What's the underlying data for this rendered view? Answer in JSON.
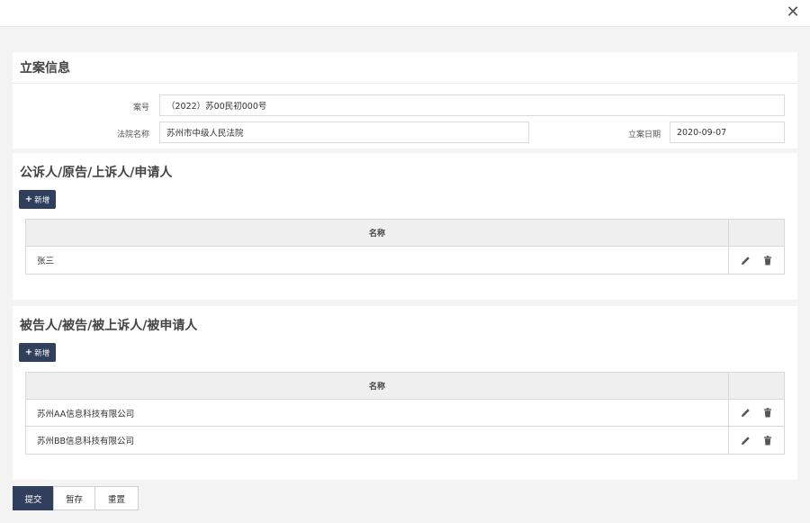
{
  "dialog": {
    "close_symbol": "✕"
  },
  "case_info": {
    "title": "立案信息",
    "case_no_label": "案号",
    "case_no_value": "（2022）苏00民初000号",
    "court_label": "法院名称",
    "court_value": "苏州市中级人民法院",
    "filing_date_label": "立案日期",
    "filing_date_value": "2020-09-07"
  },
  "plaintiffs": {
    "title": "公诉人/原告/上诉人/申请人",
    "add_label": "新增",
    "column_name": "名称",
    "rows": [
      "张三"
    ]
  },
  "defendants": {
    "title": "被告人/被告/被上诉人/被申请人",
    "add_label": "新增",
    "column_name": "名称",
    "rows": [
      "苏州AA信息科技有限公司",
      "苏州BB信息科技有限公司"
    ]
  },
  "actions": {
    "submit_label": "提交",
    "save_draft_label": "暂存",
    "reset_label": "重置"
  },
  "icons": {
    "edit": "pencil-icon",
    "delete": "trash-icon",
    "close": "close-icon"
  },
  "colors": {
    "primary": "#2f3f5c",
    "background": "#f3f3f3",
    "border": "#d8d8d8"
  }
}
